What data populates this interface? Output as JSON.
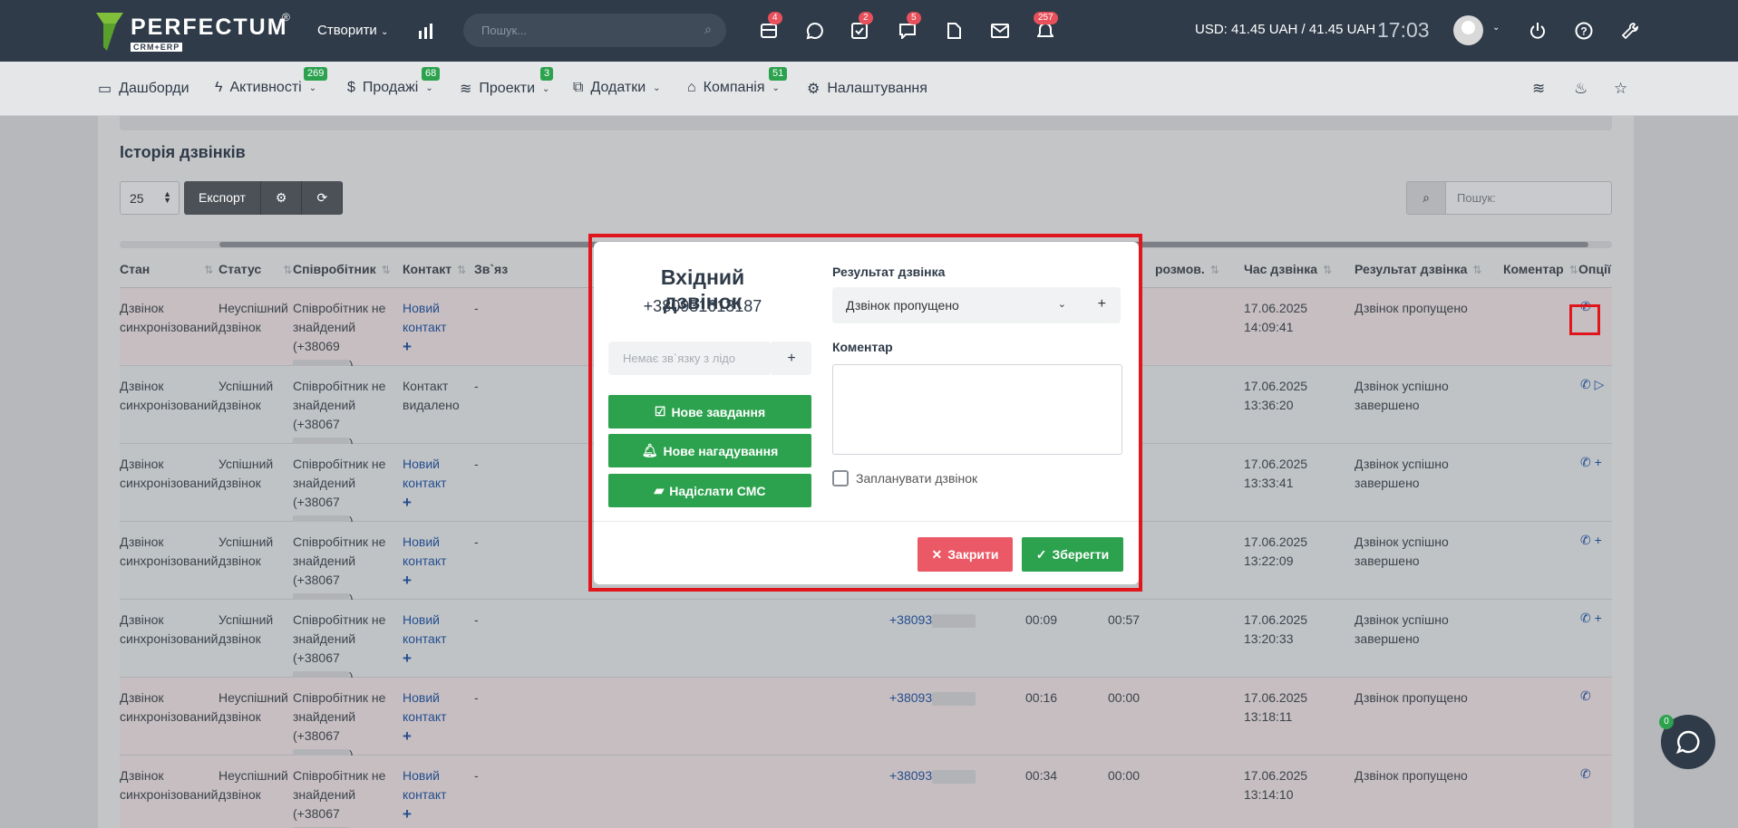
{
  "topbar": {
    "logo_name": "PERFECTUM",
    "logo_sub": "CRM+ERP",
    "logo_reg": "®",
    "create_label": "Створити",
    "search_placeholder": "Пошук...",
    "badges": {
      "tasks": "4",
      "checks": "2",
      "messages": "5",
      "notifications": "257"
    },
    "currency": "USD: 41.45 UAH / 41.45 UAH",
    "time": "17:03"
  },
  "nav": {
    "items": [
      {
        "label": "Дашборди",
        "badge": ""
      },
      {
        "label": "Активності",
        "badge": "269"
      },
      {
        "label": "Продажі",
        "badge": "68"
      },
      {
        "label": "Проекти",
        "badge": "3"
      },
      {
        "label": "Додатки",
        "badge": ""
      },
      {
        "label": "Компанія",
        "badge": "51"
      },
      {
        "label": "Налаштування",
        "badge": ""
      }
    ]
  },
  "page": {
    "title": "Історія дзвінків",
    "per_page": "25",
    "export_label": "Експорт",
    "search_placeholder": "Пошук:"
  },
  "table": {
    "headers": [
      "Стан",
      "Статус",
      "Співробітник",
      "Контакт",
      "Зв`яз",
      "розмов.",
      "Час дзвінка",
      "Результат дзвінка",
      "Коментар",
      "Опції"
    ],
    "rows": [
      {
        "state": "Дзвінок синхронізований",
        "status": "Неуспішний дзвінок",
        "employee": "Співробітник не знайдений",
        "emp_phone": "(+38069",
        "contact": "Новий контакт",
        "link": "-",
        "phone": "",
        "d1": "",
        "d2": "",
        "time": "17.06.2025 14:09:41",
        "result": "Дзвінок пропущено"
      },
      {
        "state": "Дзвінок синхронізований",
        "status": "Успішний дзвінок",
        "employee": "Співробітник не знайдений",
        "emp_phone": "(+38067",
        "contact": "Контакт видалено",
        "link": "-",
        "phone": "",
        "d1": "",
        "d2": "",
        "time": "17.06.2025 13:36:20",
        "result": "Дзвінок успішно завершено"
      },
      {
        "state": "Дзвінок синхронізований",
        "status": "Успішний дзвінок",
        "employee": "Співробітник не знайдений",
        "emp_phone": "(+38067",
        "contact": "Новий контакт",
        "link": "-",
        "phone": "",
        "d1": "",
        "d2": "",
        "time": "17.06.2025 13:33:41",
        "result": "Дзвінок успішно завершено"
      },
      {
        "state": "Дзвінок синхронізований",
        "status": "Успішний дзвінок",
        "employee": "Співробітник не знайдений",
        "emp_phone": "(+38067",
        "contact": "Новий контакт",
        "link": "-",
        "phone": "",
        "d1": "",
        "d2": "",
        "time": "17.06.2025 13:22:09",
        "result": "Дзвінок успішно завершено"
      },
      {
        "state": "Дзвінок синхронізований",
        "status": "Успішний дзвінок",
        "employee": "Співробітник не знайдений",
        "emp_phone": "(+38067",
        "contact": "Новий контакт",
        "link": "-",
        "phone": "+38093",
        "d1": "00:09",
        "d2": "00:57",
        "time": "17.06.2025 13:20:33",
        "result": "Дзвінок успішно завершено"
      },
      {
        "state": "Дзвінок синхронізований",
        "status": "Неуспішний дзвінок",
        "employee": "Співробітник не знайдений",
        "emp_phone": "(+38067",
        "contact": "Новий контакт",
        "link": "-",
        "phone": "+38093",
        "d1": "00:16",
        "d2": "00:00",
        "time": "17.06.2025 13:18:11",
        "result": "Дзвінок пропущено"
      },
      {
        "state": "Дзвінок синхронізований",
        "status": "Неуспішний дзвінок",
        "employee": "Співробітник не знайдений",
        "emp_phone": "(+38067",
        "contact": "Новий контакт",
        "link": "-",
        "phone": "+38093",
        "d1": "00:34",
        "d2": "00:00",
        "time": "17.06.2025 13:14:10",
        "result": "Дзвінок пропущено"
      }
    ]
  },
  "modal": {
    "title": "Вхідний дзвінок",
    "phone": "+380931613187",
    "lead_placeholder": "Немає зв`язку з лідо",
    "new_task": "Нове завдання",
    "new_reminder": "Нове нагадування",
    "send_sms": "Надіслати СМС",
    "result_label": "Результат дзвінка",
    "result_value": "Дзвінок пропущено",
    "comment_label": "Коментар",
    "schedule_label": "Запланувати дзвінок",
    "close_label": "Закрити",
    "save_label": "Зберегти"
  },
  "chat": {
    "badge": "0"
  },
  "colors": {
    "primary": "#2ca24e",
    "danger": "#ea5965",
    "topbar": "#2f3b49",
    "highlight": "#e0161d"
  }
}
